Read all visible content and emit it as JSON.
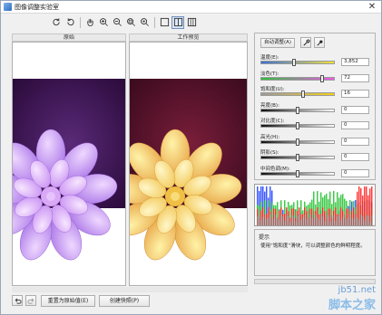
{
  "window": {
    "title": "图像调整实验室",
    "close_glyph": "✕"
  },
  "toolbar": {
    "icons": [
      "rotate-left-icon",
      "rotate-right-icon",
      "hand-icon",
      "zoom-in-icon",
      "zoom-out-icon",
      "zoom-fit-icon",
      "zoom-actual-icon",
      "view-single-icon",
      "view-split-icon",
      "view-split-horizontal-icon"
    ],
    "active_view": "view-split-icon"
  },
  "panes": {
    "original_label": "原始",
    "preview_label": "工作预览"
  },
  "bottom": {
    "reset_label": "重置为原始值(E)",
    "snapshot_label": "创建快照(P)"
  },
  "controls": {
    "auto_adjust_label": "自动调整(A)",
    "sliders": [
      {
        "label": "温度(E):",
        "value": "3,852",
        "level": 0.45,
        "gradient": [
          "#3a6fd8",
          "#f4e23a"
        ]
      },
      {
        "label": "淡色(T):",
        "value": "72",
        "level": 0.86,
        "gradient": [
          "#2fbf3a",
          "#ee5ae8"
        ]
      },
      {
        "label": "饱和度(U):",
        "value": "16",
        "level": 0.58,
        "gradient": [
          "#9a9a9a",
          "#f5d020"
        ]
      },
      {
        "label": "亮度(B):",
        "value": "0",
        "level": 0.5,
        "gradient": [
          "#111111",
          "#ffffff"
        ]
      },
      {
        "label": "对比度(C):",
        "value": "0",
        "level": 0.5,
        "gradient": [
          "#111111",
          "#ffffff"
        ]
      },
      {
        "label": "高光(H):",
        "value": "0",
        "level": 0.5,
        "gradient": [
          "#111111",
          "#ffffff"
        ]
      },
      {
        "label": "阴影(S):",
        "value": "0",
        "level": 0.5,
        "gradient": [
          "#111111",
          "#ffffff"
        ]
      },
      {
        "label": "中间色调(M):",
        "value": "0",
        "level": 0.5,
        "gradient": [
          "#111111",
          "#ffffff"
        ]
      }
    ]
  },
  "tip": {
    "title": "提示",
    "body": "使用“饱和度”滑块，可以调整颜色的鲜明程度。"
  },
  "watermark": {
    "url": "jb51.net",
    "name": "脚本之家"
  },
  "colors": {
    "original_flower": "#b98ef0",
    "preview_flower": "#f2cf55",
    "background_purple": "#3b0d4a",
    "background_red": "#5a0f25"
  }
}
